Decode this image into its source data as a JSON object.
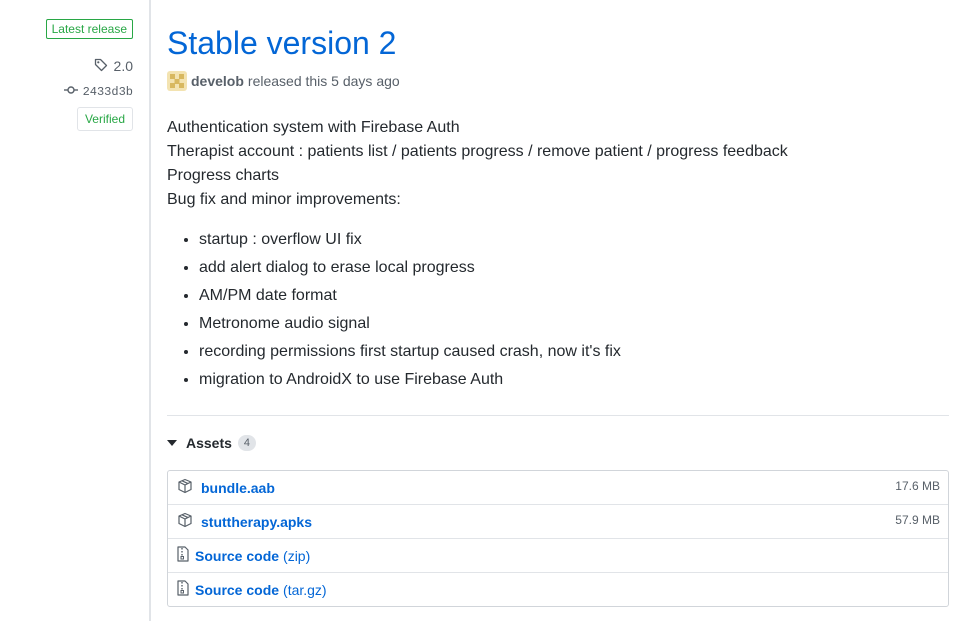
{
  "sidebar": {
    "latest_label": "Latest release",
    "tag": "2.0",
    "commit": "2433d3b",
    "verified_label": "Verified"
  },
  "release": {
    "title": "Stable version 2",
    "author": "develob",
    "released_text": "released this 5 days ago",
    "description": [
      "Authentication system with Firebase Auth",
      "Therapist account : patients list / patients progress / remove patient / progress feedback",
      "Progress charts",
      "Bug fix and minor improvements:"
    ],
    "bullets": [
      "startup : overflow UI fix",
      "add alert dialog to erase local progress",
      "AM/PM date format",
      "Metronome audio signal",
      "recording permissions first startup caused crash, now it's fix",
      "migration to AndroidX to use Firebase Auth"
    ]
  },
  "assets": {
    "label": "Assets",
    "count": "4",
    "items": [
      {
        "name": "bundle.aab",
        "size": "17.6 MB",
        "icon": "package-icon"
      },
      {
        "name": "stuttherapy.apks",
        "size": "57.9 MB",
        "icon": "package-icon"
      },
      {
        "name": "Source code",
        "ext": "(zip)",
        "icon": "file-zip-icon"
      },
      {
        "name": "Source code",
        "ext": "(tar.gz)",
        "icon": "file-zip-icon"
      }
    ]
  },
  "colors": {
    "link": "#0366d6",
    "green": "#28a745",
    "muted": "#586069",
    "border": "#e1e4e8"
  }
}
